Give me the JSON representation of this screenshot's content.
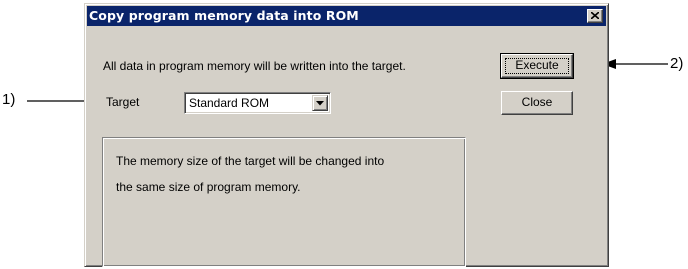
{
  "dialog": {
    "title": "Copy program memory data into ROM",
    "close_icon": "close-x-icon",
    "description": "All data in program memory will be written into the target.",
    "target_label": "Target",
    "target_value": "Standard ROM",
    "dropdown_icon": "chevron-down-icon",
    "buttons": {
      "execute": "Execute",
      "close": "Close"
    },
    "info_lines": [
      "The memory size of the target will be changed into",
      "the same size of program memory."
    ]
  },
  "annotations": {
    "callout_1": "1)",
    "callout_2": "2)"
  },
  "colors": {
    "titlebar": "#0a246a",
    "dialog_face": "#d4d0c8",
    "title_text": "#ffffff"
  }
}
